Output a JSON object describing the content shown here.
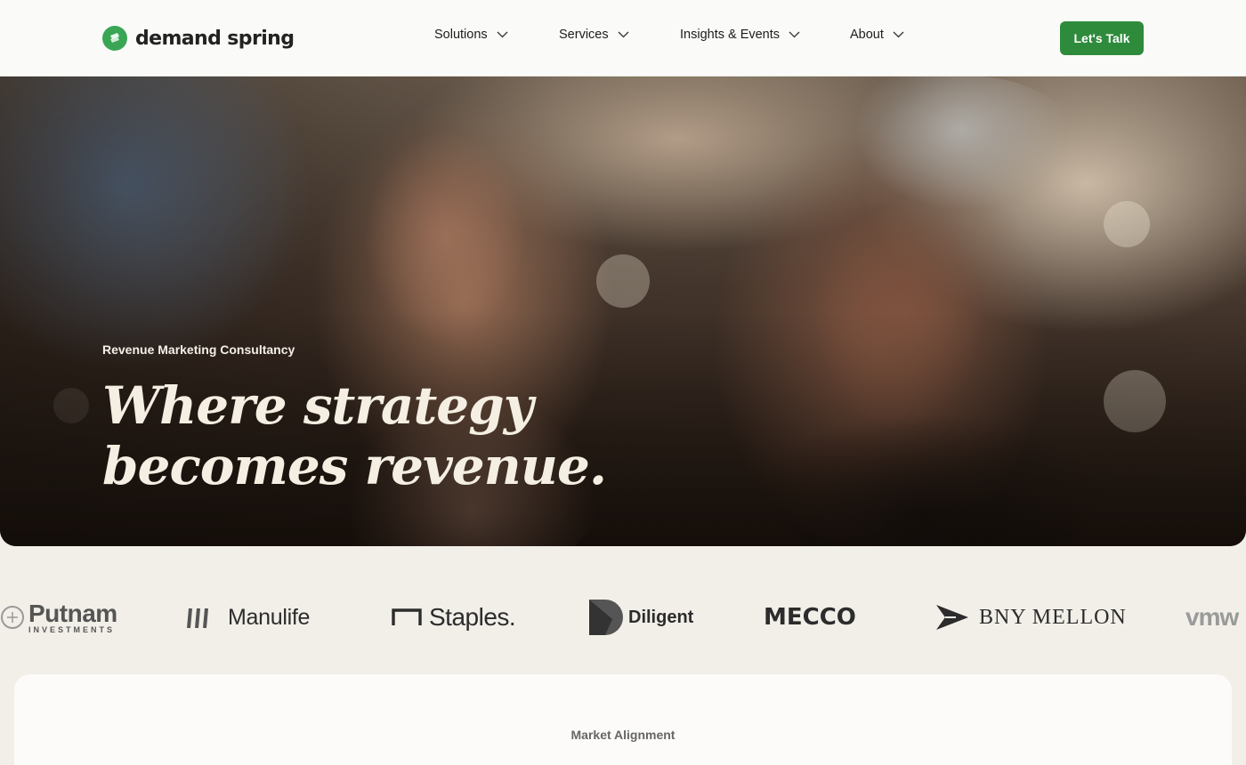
{
  "header": {
    "brand": "demand spring",
    "nav": [
      {
        "label": "Solutions"
      },
      {
        "label": "Services"
      },
      {
        "label": "Insights & Events"
      },
      {
        "label": "About"
      }
    ],
    "cta_label": "Let's Talk"
  },
  "hero": {
    "eyebrow": "Revenue Marketing Consultancy",
    "title_line1": "Where strategy",
    "title_line2": "becomes revenue."
  },
  "clients": {
    "logos": [
      {
        "name": "Putnam",
        "sub": "INVESTMENTS"
      },
      {
        "name": "Manulife"
      },
      {
        "name": "Staples."
      },
      {
        "name": "Diligent"
      },
      {
        "name": "MECCO"
      },
      {
        "name": "BNY MELLON"
      },
      {
        "name": "vmw"
      }
    ]
  },
  "section": {
    "label": "Market Alignment"
  },
  "colors": {
    "accent": "#2e8b3b",
    "background": "#f2efe8",
    "header_bg": "#fafaf8"
  }
}
